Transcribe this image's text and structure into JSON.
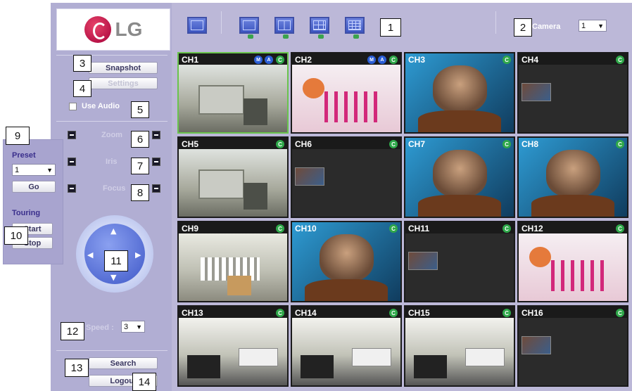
{
  "logo": {
    "text": "LG"
  },
  "controls": {
    "snapshot_label": "Snapshot",
    "settings_label": "Settings",
    "use_audio_label": "Use Audio",
    "zoom_label": "Zoom",
    "iris_label": "Iris",
    "focus_label": "Focus",
    "speed_label": "Speed :",
    "speed_value": "3",
    "search_label": "Search",
    "logout_label": "Logout"
  },
  "preset": {
    "title": "Preset",
    "value": "1",
    "go_label": "Go",
    "touring_title": "Touring",
    "start_label": "Start",
    "stop_label": "Stop"
  },
  "topbar": {
    "camera_label": "Camera",
    "camera_value": "1"
  },
  "channels": [
    {
      "label": "CH1",
      "scene": "office"
    },
    {
      "label": "CH2",
      "scene": "dance"
    },
    {
      "label": "CH3",
      "scene": "face"
    },
    {
      "label": "CH4",
      "scene": "dark"
    },
    {
      "label": "CH5",
      "scene": "office"
    },
    {
      "label": "CH6",
      "scene": "dark"
    },
    {
      "label": "CH7",
      "scene": "face"
    },
    {
      "label": "CH8",
      "scene": "face"
    },
    {
      "label": "CH9",
      "scene": "lab"
    },
    {
      "label": "CH10",
      "scene": "face"
    },
    {
      "label": "CH11",
      "scene": "dark"
    },
    {
      "label": "CH12",
      "scene": "dance"
    },
    {
      "label": "CH13",
      "scene": "room"
    },
    {
      "label": "CH14",
      "scene": "room"
    },
    {
      "label": "CH15",
      "scene": "room"
    },
    {
      "label": "CH16",
      "scene": "dark"
    }
  ],
  "callouts": [
    "1",
    "2",
    "3",
    "4",
    "5",
    "6",
    "7",
    "8",
    "9",
    "10",
    "11",
    "12",
    "13",
    "14"
  ],
  "colors": {
    "panel": "#b1aed3",
    "selected_border": "#6ac44d",
    "status_green": "#2fa84a",
    "ptz_blue": "#3f58c8"
  }
}
